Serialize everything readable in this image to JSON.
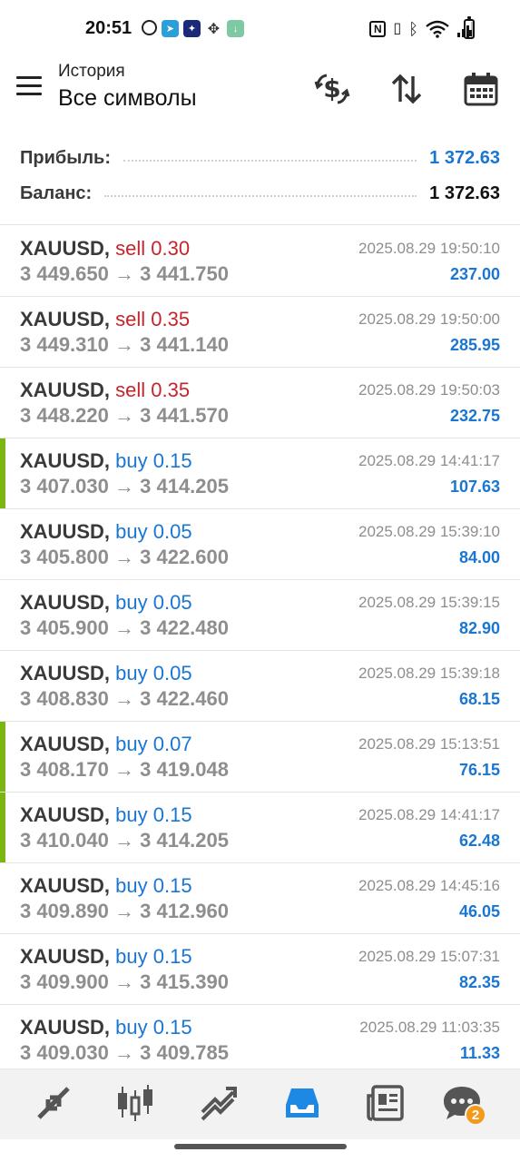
{
  "status_bar": {
    "time": "20:51",
    "left_icons": [
      "alarm-icon",
      "telegram-icon",
      "stars-app-icon",
      "fan-icon",
      "download-icon"
    ],
    "right_icons": [
      "nfc-icon",
      "vibrate-icon",
      "bluetooth-icon",
      "wifi-icon",
      "signal-icon",
      "battery-icon"
    ]
  },
  "header": {
    "subtitle": "История",
    "title": "Все символы",
    "actions": [
      "currency-exchange-icon",
      "sort-icon",
      "calendar-icon"
    ]
  },
  "summary": {
    "profit_label": "Прибыль:",
    "profit_value": "1 372.63",
    "balance_label": "Баланс:",
    "balance_value": "1 372.63"
  },
  "colors": {
    "sell": "#c8232c",
    "buy": "#1976d2",
    "profit": "#1976d2",
    "marker": "#7cb512",
    "active_tab": "#1e88e5",
    "badge": "#f49a1a"
  },
  "deals": [
    {
      "symbol": "XAUUSD,",
      "side": "sell",
      "volume": "0.30",
      "open": "3 449.650",
      "close": "3 441.750",
      "time": "2025.08.29 19:50:10",
      "profit": "237.00",
      "marker": false
    },
    {
      "symbol": "XAUUSD,",
      "side": "sell",
      "volume": "0.35",
      "open": "3 449.310",
      "close": "3 441.140",
      "time": "2025.08.29 19:50:00",
      "profit": "285.95",
      "marker": false
    },
    {
      "symbol": "XAUUSD,",
      "side": "sell",
      "volume": "0.35",
      "open": "3 448.220",
      "close": "3 441.570",
      "time": "2025.08.29 19:50:03",
      "profit": "232.75",
      "marker": false
    },
    {
      "symbol": "XAUUSD,",
      "side": "buy",
      "volume": "0.15",
      "open": "3 407.030",
      "close": "3 414.205",
      "time": "2025.08.29 14:41:17",
      "profit": "107.63",
      "marker": true
    },
    {
      "symbol": "XAUUSD,",
      "side": "buy",
      "volume": "0.05",
      "open": "3 405.800",
      "close": "3 422.600",
      "time": "2025.08.29 15:39:10",
      "profit": "84.00",
      "marker": false
    },
    {
      "symbol": "XAUUSD,",
      "side": "buy",
      "volume": "0.05",
      "open": "3 405.900",
      "close": "3 422.480",
      "time": "2025.08.29 15:39:15",
      "profit": "82.90",
      "marker": false
    },
    {
      "symbol": "XAUUSD,",
      "side": "buy",
      "volume": "0.05",
      "open": "3 408.830",
      "close": "3 422.460",
      "time": "2025.08.29 15:39:18",
      "profit": "68.15",
      "marker": false
    },
    {
      "symbol": "XAUUSD,",
      "side": "buy",
      "volume": "0.07",
      "open": "3 408.170",
      "close": "3 419.048",
      "time": "2025.08.29 15:13:51",
      "profit": "76.15",
      "marker": true
    },
    {
      "symbol": "XAUUSD,",
      "side": "buy",
      "volume": "0.15",
      "open": "3 410.040",
      "close": "3 414.205",
      "time": "2025.08.29 14:41:17",
      "profit": "62.48",
      "marker": true
    },
    {
      "symbol": "XAUUSD,",
      "side": "buy",
      "volume": "0.15",
      "open": "3 409.890",
      "close": "3 412.960",
      "time": "2025.08.29 14:45:16",
      "profit": "46.05",
      "marker": false
    },
    {
      "symbol": "XAUUSD,",
      "side": "buy",
      "volume": "0.15",
      "open": "3 409.900",
      "close": "3 415.390",
      "time": "2025.08.29 15:07:31",
      "profit": "82.35",
      "marker": false
    },
    {
      "symbol": "XAUUSD,",
      "side": "buy",
      "volume": "0.15",
      "open": "3 409.030",
      "close": "3 409.785",
      "time": "2025.08.29 11:03:35",
      "profit": "11.33",
      "marker": false
    }
  ],
  "bottom_nav": {
    "tabs": [
      "quotes-icon",
      "chart-icon",
      "trade-icon",
      "history-icon",
      "news-icon",
      "chat-icon"
    ],
    "active": "history-icon",
    "chat_badge": "2"
  }
}
